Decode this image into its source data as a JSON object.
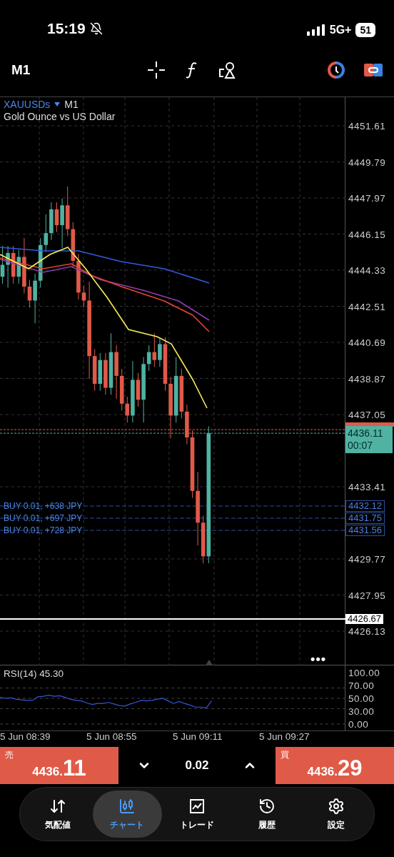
{
  "status_bar": {
    "time": "15:19",
    "network": "5G+",
    "battery": "51"
  },
  "toolbar": {
    "timeframe": "M1"
  },
  "chart": {
    "symbol": "XAUUSDs",
    "timeframe": "M1",
    "description": "Gold Ounce vs US Dollar",
    "price_labels": [
      "4451.61",
      "4449.79",
      "4447.97",
      "4446.15",
      "4444.33",
      "4442.51",
      "4440.69",
      "4438.87",
      "4437.05",
      "4433.41",
      "4429.77",
      "4427.95",
      "4426.13"
    ],
    "current_price": {
      "price": "4436.11",
      "countdown": "00:07"
    },
    "positions": [
      {
        "label": "BUY 0.01, +638 JPY",
        "price": "4432.12"
      },
      {
        "label": "BUY 0.01, +697 JPY",
        "price": "4431.75"
      },
      {
        "label": "BUY 0.01, +728 JPY",
        "price": "4431.56"
      }
    ],
    "line_price": "4426.67",
    "more": "•••"
  },
  "rsi": {
    "label": "RSI(14)",
    "value": "45.30",
    "levels": [
      "100.00",
      "70.00",
      "50.00",
      "30.00",
      "0.00"
    ]
  },
  "time_labels": [
    "5 Jun 08:39",
    "5 Jun 08:55",
    "5 Jun 09:11",
    "5 Jun 09:27"
  ],
  "trade": {
    "sell": {
      "label": "売",
      "price_main": "4436.",
      "price_big": "11"
    },
    "volume": "0.02",
    "buy": {
      "label": "買",
      "price_main": "4436.",
      "price_big": "29"
    }
  },
  "nav": [
    {
      "label": "気配値",
      "selected": false
    },
    {
      "label": "チャート",
      "selected": true
    },
    {
      "label": "トレード",
      "selected": false
    },
    {
      "label": "履歴",
      "selected": false
    },
    {
      "label": "設定",
      "selected": false
    }
  ]
}
